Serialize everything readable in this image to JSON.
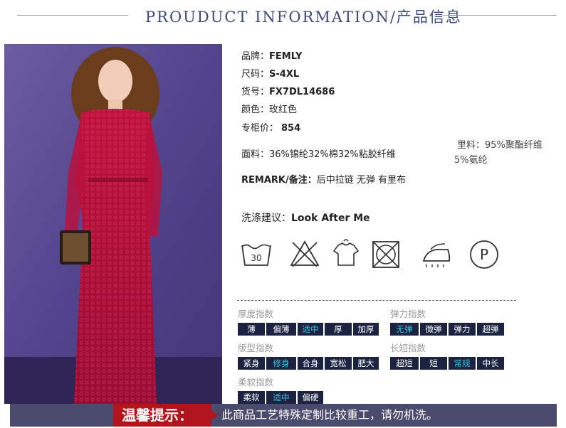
{
  "header": {
    "title": "PROUDUCT INFORMATION/产品信息"
  },
  "product": {
    "brand_label": "品牌：",
    "brand": "FEMLY",
    "size_label": "尺码：",
    "size": "S-4XL",
    "sku_label": "货号：",
    "sku": "FX7DL14686",
    "color_label": "颜色：",
    "color": "玫红色",
    "price_label": "专柜价：",
    "price": "854",
    "fabric_label": "面料：",
    "fabric": "36%锦纶32%棉32%粘胶纤维",
    "lining_label": "里料：",
    "lining_line1": "95%聚酯纤维",
    "lining_line2": "5%氨纶",
    "remark_label": "REMARK/备注：",
    "remark": "后中拉链 无弹 有里布"
  },
  "wash": {
    "label": "洗涤建议：",
    "value": "Look After Me",
    "icons": [
      "wash-30-icon",
      "no-bleach-icon",
      "hang-dry-icon",
      "no-tumble-dry-icon",
      "low-iron-icon",
      "dry-clean-p-icon"
    ],
    "wash_temp": "30",
    "dryclean_letter": "P"
  },
  "indices": {
    "thickness": {
      "title": "厚度指数",
      "options": [
        "薄",
        "偏薄",
        "适中",
        "厚",
        "加厚"
      ],
      "selected": "适中"
    },
    "elasticity": {
      "title": "弹力指数",
      "options": [
        "无弹",
        "微弹",
        "弹力",
        "超弹"
      ],
      "selected": "无弹"
    },
    "fit": {
      "title": "版型指数",
      "options": [
        "紧身",
        "修身",
        "合身",
        "宽松",
        "肥大"
      ],
      "selected": "修身"
    },
    "length": {
      "title": "长短指数",
      "options": [
        "超短",
        "短",
        "常规",
        "中长"
      ],
      "selected": "常规"
    },
    "softness": {
      "title": "柔软指数",
      "options": [
        "柔软",
        "适中",
        "偏硬"
      ],
      "selected": "适中"
    }
  },
  "notice": {
    "tag": "温馨提示：",
    "text": "此商品工艺特殊定制比较重工，请勿机洗。"
  },
  "colors": {
    "chip_bg": "#1b2340",
    "chip_selected_text": "#39c7e8",
    "notice_bar": "#4a4a6c",
    "notice_tag": "#b3151d",
    "dress": "#b0103a",
    "backdrop": "#5a4a8c"
  }
}
